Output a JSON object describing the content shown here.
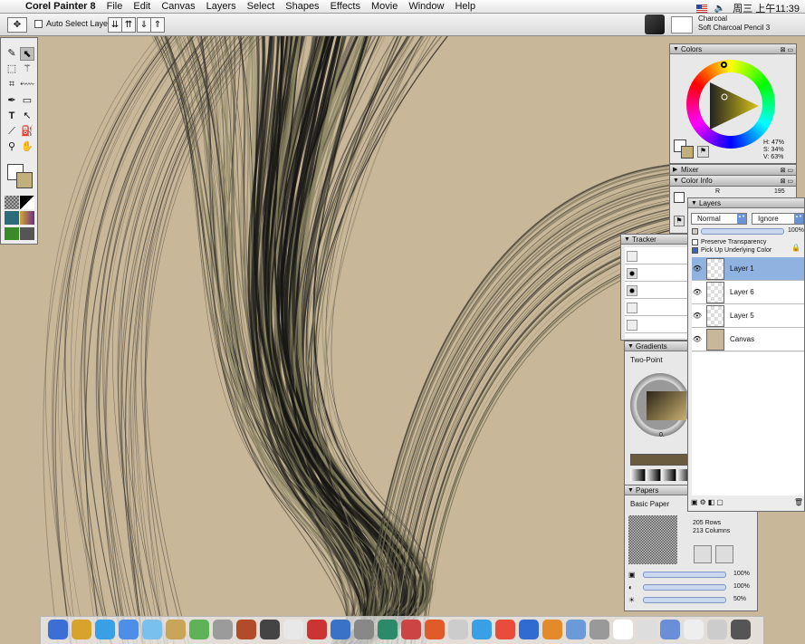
{
  "menubar": {
    "app_name": "Corel Painter 8",
    "menus": [
      "File",
      "Edit",
      "Canvas",
      "Layers",
      "Select",
      "Shapes",
      "Effects",
      "Movie",
      "Window",
      "Help"
    ],
    "clock": "周三 上午11:39"
  },
  "propbar": {
    "auto_select_label": "Auto Select Layer",
    "brush_category": "Charcoal",
    "brush_variant": "Soft Charcoal Pencil 3"
  },
  "colors_panel": {
    "title": "Colors",
    "hue": "H: 47%",
    "saturation": "S: 34%",
    "value": "V: 63%",
    "main_color": "#c1b07a",
    "secondary_color": "#ffffff"
  },
  "mixer_panel": {
    "title": "Mixer"
  },
  "color_info_panel": {
    "title": "Color Info",
    "r_label": "R",
    "r_value": "195"
  },
  "layers_panel": {
    "title": "Layers",
    "composite_method": "Normal",
    "depth": "Ignore",
    "opacity": "100%",
    "preserve_transparency": "Preserve Transparency",
    "pick_up_underlying": "Pick Up Underlying Color",
    "layers": [
      {
        "name": "Layer 1",
        "selected": true
      },
      {
        "name": "Layer 6",
        "selected": false
      },
      {
        "name": "Layer 5",
        "selected": false
      },
      {
        "name": "Canvas",
        "selected": false
      }
    ]
  },
  "tracker_panel": {
    "title": "Tracker"
  },
  "gradients_panel": {
    "title": "Gradients",
    "type": "Two-Point",
    "angle": "0."
  },
  "papers_panel": {
    "title": "Papers",
    "paper_name": "Basic Paper",
    "rows": "205 Rows",
    "columns": "213 Columns",
    "scale": "100%",
    "contrast": "100%",
    "brightness": "50%"
  },
  "colors": {
    "canvas_bg": "#c9b79a",
    "hair_dark": "#141412",
    "hair_olive": "#8a8563",
    "selection": "#8fb2e0"
  }
}
